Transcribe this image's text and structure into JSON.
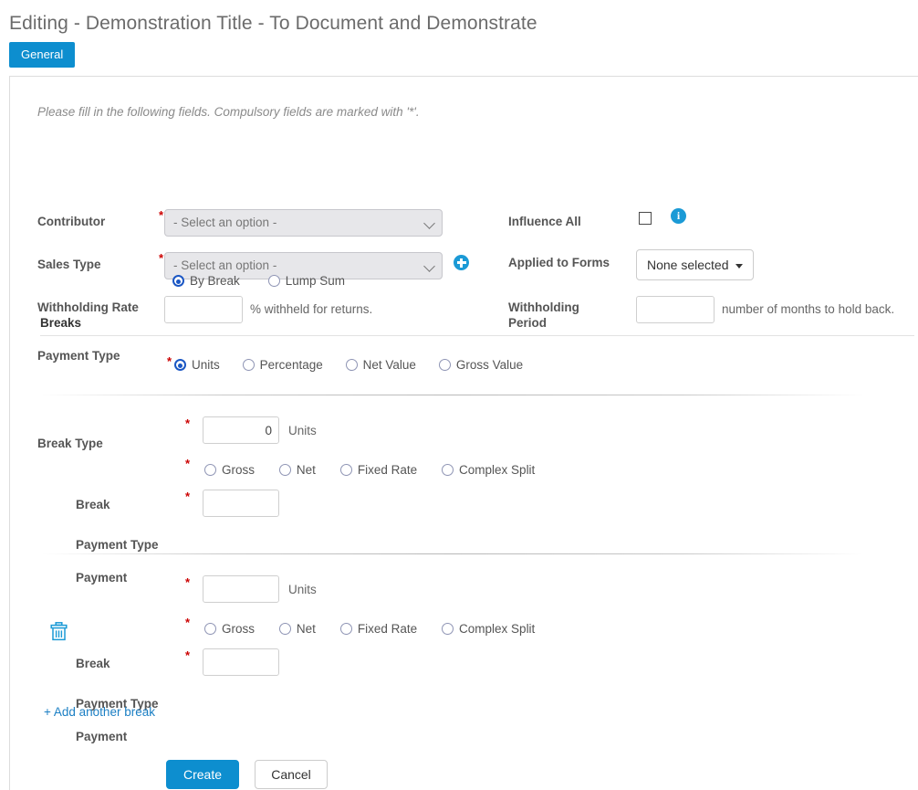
{
  "header": {
    "title": "Editing - Demonstration Title - To Document and Demonstrate",
    "tabs": [
      {
        "label": "General",
        "active": true
      }
    ]
  },
  "form": {
    "note": "Please fill in the following fields. Compulsory fields are marked with '*'.",
    "required_marker": "*",
    "contributor": {
      "label": "Contributor",
      "value": "- Select an option -",
      "required": true
    },
    "sales_type": {
      "label": "Sales Type",
      "value": "- Select an option -",
      "required": true,
      "add_icon": "plus-circle-icon"
    },
    "withholding_rate": {
      "label": "Withholding Rate",
      "value": "",
      "suffix": "% withheld for returns."
    },
    "influence_all": {
      "label": "Influence All",
      "checked": false,
      "info_icon": "info-circle-icon",
      "info_glyph": "i"
    },
    "applied_to_forms": {
      "label": "Applied to Forms",
      "value": "None selected"
    },
    "withholding_period": {
      "label": "Withholding Period",
      "label_line1": "Withholding",
      "label_line2": "Period",
      "value": "",
      "suffix": "number of months to hold back."
    },
    "payment_type": {
      "label": "Payment Type",
      "options": [
        {
          "label": "By Break",
          "selected": true
        },
        {
          "label": "Lump Sum",
          "selected": false
        }
      ]
    }
  },
  "breaks_section": {
    "title": "Breaks",
    "break_type": {
      "label": "Break Type",
      "required": true,
      "options": [
        {
          "label": "Units",
          "selected": true
        },
        {
          "label": "Percentage",
          "selected": false
        },
        {
          "label": "Net Value",
          "selected": false
        },
        {
          "label": "Gross Value",
          "selected": false
        }
      ]
    },
    "break_rows": [
      {
        "break": {
          "label": "Break",
          "value": "0",
          "unit": "Units",
          "required": true
        },
        "payment_type": {
          "label": "Payment Type",
          "required": true,
          "options": [
            {
              "label": "Gross",
              "selected": false
            },
            {
              "label": "Net",
              "selected": false
            },
            {
              "label": "Fixed Rate",
              "selected": false
            },
            {
              "label": "Complex Split",
              "selected": false
            }
          ]
        },
        "payment": {
          "label": "Payment",
          "value": "",
          "required": true
        },
        "has_delete": false
      },
      {
        "break": {
          "label": "Break",
          "value": "",
          "unit": "Units",
          "required": true
        },
        "payment_type": {
          "label": "Payment Type",
          "required": true,
          "options": [
            {
              "label": "Gross",
              "selected": false
            },
            {
              "label": "Net",
              "selected": false
            },
            {
              "label": "Fixed Rate",
              "selected": false
            },
            {
              "label": "Complex Split",
              "selected": false
            }
          ]
        },
        "payment": {
          "label": "Payment",
          "value": "",
          "required": true
        },
        "has_delete": true,
        "delete_icon": "trash-icon"
      }
    ],
    "add_break_link": "+ Add another break"
  },
  "footer": {
    "create_label": "Create",
    "cancel_label": "Cancel"
  },
  "colors": {
    "accent_blue": "#0d8ecf",
    "icon_blue": "#1b9ad6",
    "radio_blue": "#1b57c4",
    "required_red": "#cc0000",
    "link_blue": "#1b7fc4"
  }
}
